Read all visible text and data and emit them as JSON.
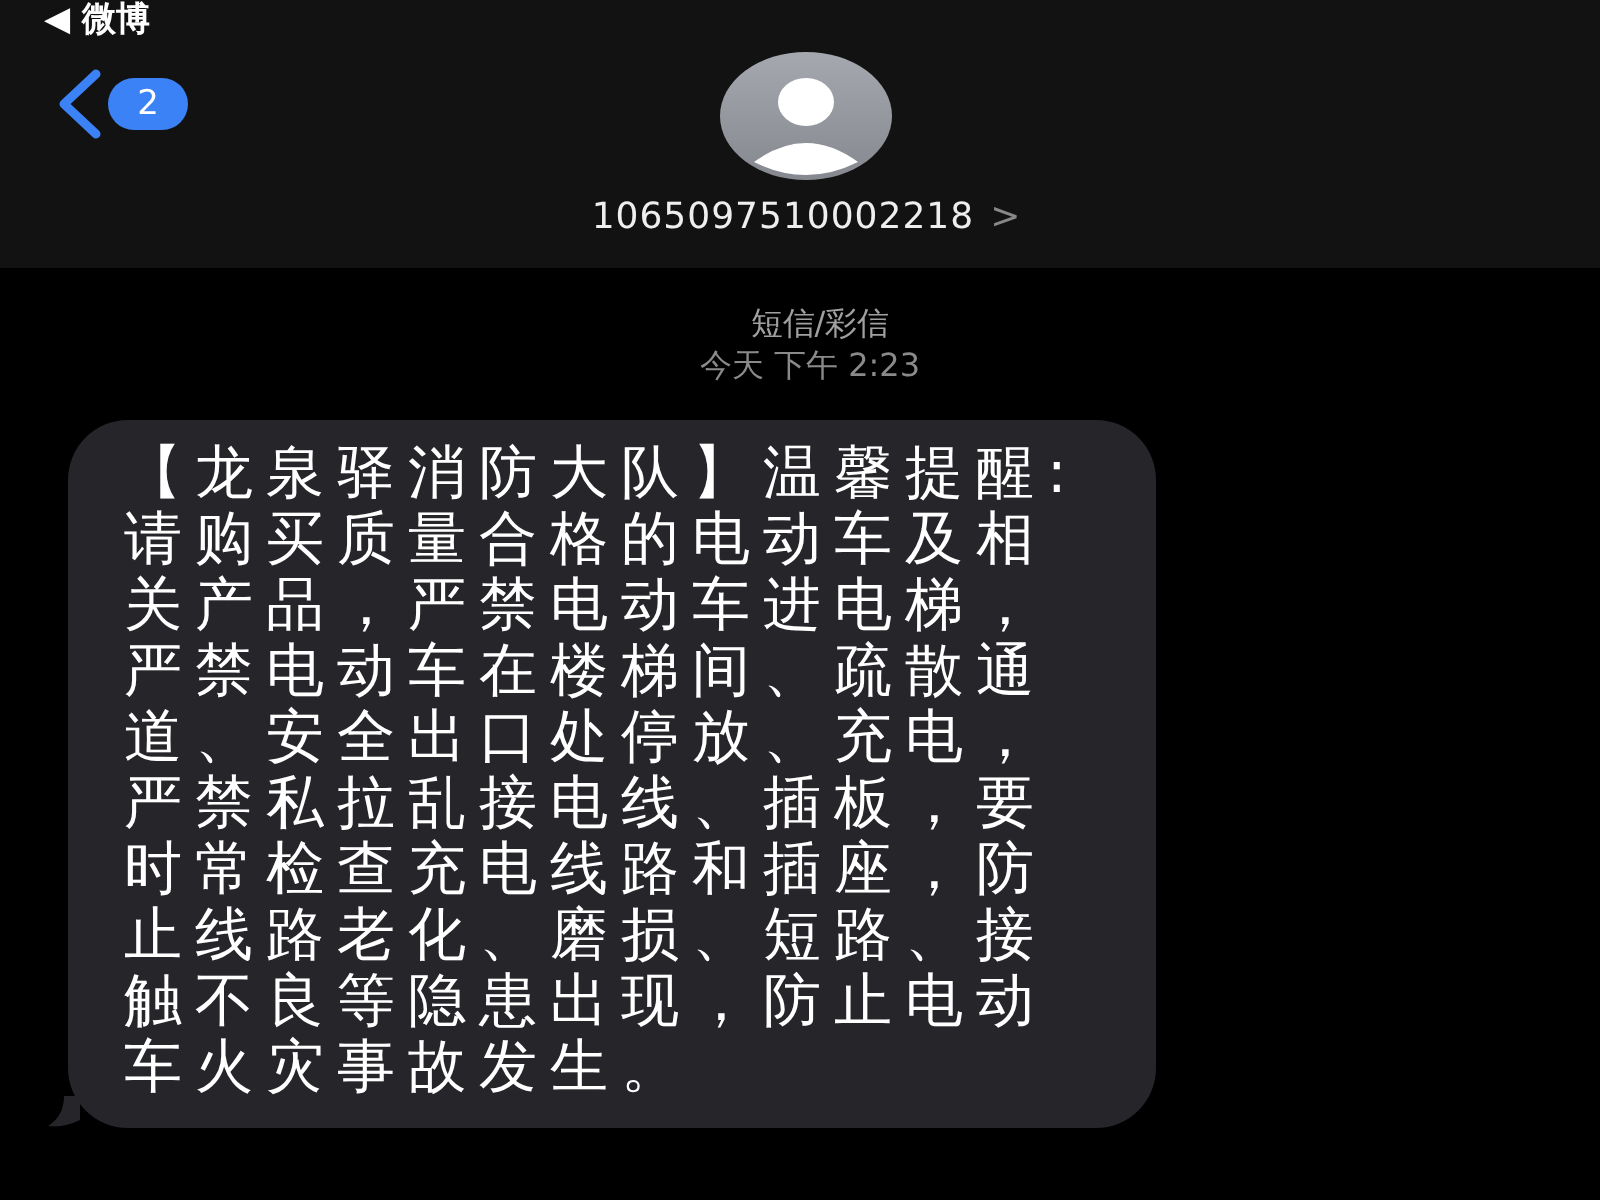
{
  "status_bar": {
    "back_label": "◀ 微博"
  },
  "header": {
    "unread_count": "2",
    "contact": "1065097510002218",
    "chevron": ">"
  },
  "thread": {
    "service": "短信/彩信",
    "timestamp_day": "今天",
    "timestamp_time": "下午 2:23"
  },
  "messages": [
    {
      "kind": "incoming",
      "text": "【龙泉驿消防大队】温馨提醒:请购买质量合格的电动车及相关产品，严禁电动车进电梯，严禁电动车在楼梯间、疏散通道、安全出口处停放、充电，严禁私拉乱接电线、插板，要时常检查充电线路和插座，防止线路老化、磨损、短路、接触不良等隐患出现，防止电动车火灾事故发生。"
    }
  ]
}
